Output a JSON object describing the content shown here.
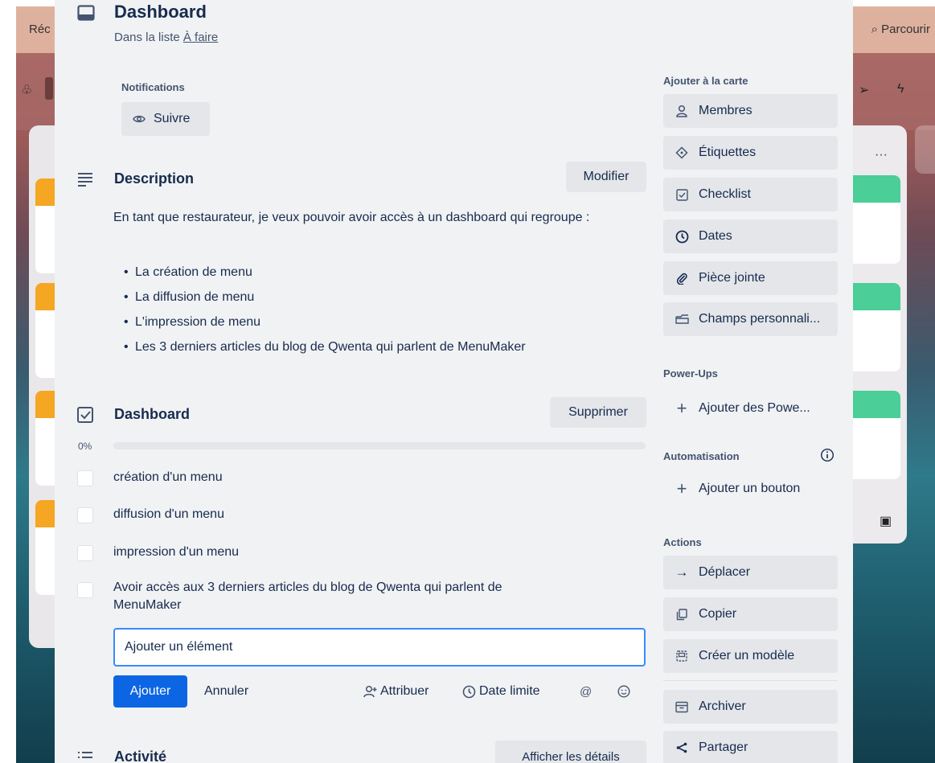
{
  "background": {
    "top_left_text": "Réc",
    "top_right_text": "Parcourir"
  },
  "card": {
    "title": "Dashboard",
    "list_prefix": "Dans la liste ",
    "list_name": "À faire"
  },
  "notifications": {
    "label": "Notifications",
    "follow_label": "Suivre"
  },
  "description": {
    "title": "Description",
    "edit_label": "Modifier",
    "text": "En tant que restaurateur, je veux pouvoir avoir accès à un dashboard qui regroupe :",
    "items": [
      "La création de menu",
      "La diffusion de menu",
      "L'impression de menu",
      "Les 3 derniers articles du blog de Qwenta qui parlent de MenuMaker"
    ]
  },
  "checklist": {
    "title": "Dashboard",
    "delete_label": "Supprimer",
    "progress_label": "0%",
    "progress": 0,
    "items": [
      "création d'un menu",
      "diffusion d'un menu",
      "impression d'un menu",
      "Avoir accès aux 3 derniers articles du blog de Qwenta qui parlent de MenuMaker"
    ],
    "add_placeholder": "Ajouter un élément",
    "add_label": "Ajouter",
    "cancel_label": "Annuler",
    "assign_label": "Attribuer",
    "due_label": "Date limite"
  },
  "activity": {
    "title": "Activité",
    "details_label": "Afficher les détails"
  },
  "sidebar": {
    "add_to_card": "Ajouter à la carte",
    "members": "Membres",
    "labels": "Étiquettes",
    "checklist": "Checklist",
    "dates": "Dates",
    "attachment": "Pièce jointe",
    "custom_fields": "Champs personnali...",
    "power_ups_head": "Power-Ups",
    "add_power_ups": "Ajouter des Powe...",
    "automation_head": "Automatisation",
    "add_button": "Ajouter un bouton",
    "actions_head": "Actions",
    "move": "Déplacer",
    "copy": "Copier",
    "create_template": "Créer un modèle",
    "archive": "Archiver",
    "share": "Partager"
  },
  "colors": {
    "primary": "#0c66e4",
    "input_border": "#388bff",
    "modal_bg": "#f1f2f4",
    "button_bg": "#e4e6ea",
    "label_green": "#4bce97",
    "label_orange": "#f5a623"
  }
}
